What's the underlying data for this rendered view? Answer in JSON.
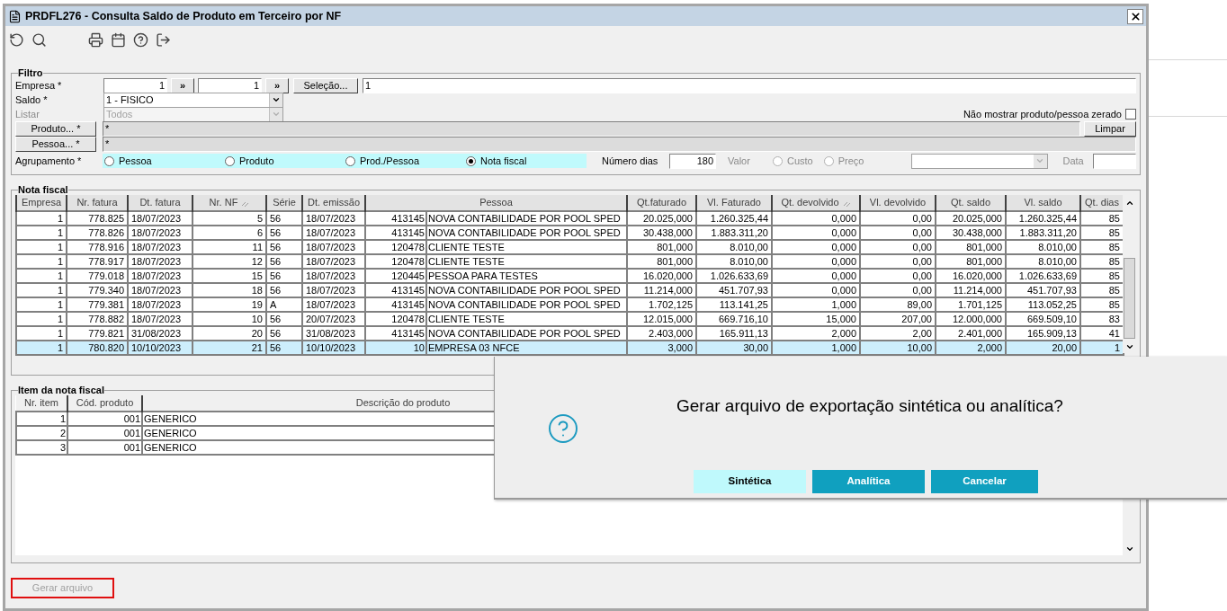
{
  "window": {
    "title": "PRDFL276 - Consulta Saldo de Produto em Terceiro por NF"
  },
  "filter": {
    "title": "Filtro",
    "empresa": {
      "label": "Empresa *",
      "from": "1",
      "from_button": "»",
      "to": "1",
      "to_button": "»",
      "selection_button": "Seleção...",
      "selection_value": "1"
    },
    "saldo": {
      "label": "Saldo *",
      "value": "1 - FISICO",
      "disabled": false
    },
    "listar": {
      "label": "Listar",
      "value": "Todos",
      "disabled": true
    },
    "hide_zero": {
      "label": "Não mostrar produto/pessoa zerado",
      "checked": false
    },
    "produto": {
      "button": "Produto... *",
      "value": "*"
    },
    "pessoa": {
      "button": "Pessoa... *",
      "value": "*"
    },
    "clear_button": "Limpar",
    "agrupamento": {
      "label": "Agrupamento *",
      "options": [
        {
          "label": "Pessoa",
          "selected": false
        },
        {
          "label": "Produto",
          "selected": false
        },
        {
          "label": "Prod./Pessoa",
          "selected": false
        },
        {
          "label": "Nota fiscal",
          "selected": true
        }
      ]
    },
    "numero_dias": {
      "label": "Número dias",
      "value": "180"
    },
    "valor": {
      "label": "Valor",
      "disabled": true,
      "options": [
        {
          "label": "Custo",
          "selected": false
        },
        {
          "label": "Preço",
          "selected": false
        }
      ]
    },
    "data": {
      "label": "Data"
    }
  },
  "nota_fiscal": {
    "title": "Nota fiscal",
    "columns": [
      {
        "label": "Empresa",
        "sorted": false
      },
      {
        "label": "Nr. fatura",
        "sorted": false
      },
      {
        "label": "Dt. fatura",
        "sorted": false
      },
      {
        "label": "Nr. NF",
        "sorted": true
      },
      {
        "label": "Série",
        "sorted": false
      },
      {
        "label": "Dt. emissão",
        "sorted": false
      },
      {
        "label": "Pessoa",
        "sorted": false
      },
      {
        "label": "Qt.faturado",
        "sorted": false
      },
      {
        "label": "Vl. Faturado",
        "sorted": false
      },
      {
        "label": "Qt. devolvido",
        "sorted": true
      },
      {
        "label": "Vl. devolvido",
        "sorted": false
      },
      {
        "label": "Qt. saldo",
        "sorted": false
      },
      {
        "label": "Vl. saldo",
        "sorted": false
      },
      {
        "label": "Qt. dias",
        "sorted": false
      }
    ],
    "rows": [
      {
        "selected": false,
        "cells": [
          "1",
          "778.825",
          "18/07/2023",
          "5",
          "56",
          "18/07/2023",
          {
            "code": "413145",
            "name": "NOVA CONTABILIDADE POR POOL SPED"
          },
          "20.025,000",
          "1.260.325,44",
          "0,000",
          "0,00",
          "20.025,000",
          "1.260.325,44",
          "85"
        ]
      },
      {
        "selected": false,
        "cells": [
          "1",
          "778.826",
          "18/07/2023",
          "6",
          "56",
          "18/07/2023",
          {
            "code": "413145",
            "name": "NOVA CONTABILIDADE POR POOL SPED"
          },
          "30.438,000",
          "1.883.311,20",
          "0,000",
          "0,00",
          "30.438,000",
          "1.883.311,20",
          "85"
        ]
      },
      {
        "selected": false,
        "cells": [
          "1",
          "778.916",
          "18/07/2023",
          "11",
          "56",
          "18/07/2023",
          {
            "code": "120478",
            "name": "CLIENTE TESTE"
          },
          "801,000",
          "8.010,00",
          "0,000",
          "0,00",
          "801,000",
          "8.010,00",
          "85"
        ]
      },
      {
        "selected": false,
        "cells": [
          "1",
          "778.917",
          "18/07/2023",
          "12",
          "56",
          "18/07/2023",
          {
            "code": "120478",
            "name": "CLIENTE TESTE"
          },
          "801,000",
          "8.010,00",
          "0,000",
          "0,00",
          "801,000",
          "8.010,00",
          "85"
        ]
      },
      {
        "selected": false,
        "cells": [
          "1",
          "779.018",
          "18/07/2023",
          "15",
          "56",
          "18/07/2023",
          {
            "code": "120445",
            "name": "PESSOA PARA TESTES"
          },
          "16.020,000",
          "1.026.633,69",
          "0,000",
          "0,00",
          "16.020,000",
          "1.026.633,69",
          "85"
        ]
      },
      {
        "selected": false,
        "cells": [
          "1",
          "779.340",
          "18/07/2023",
          "18",
          "56",
          "18/07/2023",
          {
            "code": "413145",
            "name": "NOVA CONTABILIDADE POR POOL SPED"
          },
          "11.214,000",
          "451.707,93",
          "0,000",
          "0,00",
          "11.214,000",
          "451.707,93",
          "85"
        ]
      },
      {
        "selected": false,
        "cells": [
          "1",
          "779.381",
          "18/07/2023",
          "19",
          "A",
          "18/07/2023",
          {
            "code": "413145",
            "name": "NOVA CONTABILIDADE POR POOL SPED"
          },
          "1.702,125",
          "113.141,25",
          "1,000",
          "89,00",
          "1.701,125",
          "113.052,25",
          "85"
        ]
      },
      {
        "selected": false,
        "cells": [
          "1",
          "778.882",
          "18/07/2023",
          "10",
          "56",
          "20/07/2023",
          {
            "code": "120478",
            "name": "CLIENTE TESTE"
          },
          "12.015,000",
          "669.716,10",
          "15,000",
          "207,00",
          "12.000,000",
          "669.509,10",
          "83"
        ]
      },
      {
        "selected": false,
        "cells": [
          "1",
          "779.821",
          "31/08/2023",
          "20",
          "56",
          "31/08/2023",
          {
            "code": "413145",
            "name": "NOVA CONTABILIDADE POR POOL SPED"
          },
          "2.403,000",
          "165.911,13",
          "2,000",
          "2,00",
          "2.401,000",
          "165.909,13",
          "41"
        ]
      },
      {
        "selected": true,
        "cells": [
          "1",
          "780.820",
          "10/10/2023",
          "21",
          "56",
          "10/10/2023",
          {
            "code": "10",
            "name": "EMPRESA 03 NFCE"
          },
          "3,000",
          "30,00",
          "1,000",
          "10,00",
          "2,000",
          "20,00",
          "1"
        ]
      }
    ]
  },
  "items": {
    "title": "Item da nota fiscal",
    "columns": [
      "Nr. item",
      "Cód. produto",
      "Descrição do produto"
    ],
    "rows": [
      [
        "1",
        "001",
        "GENERICO"
      ],
      [
        "2",
        "001",
        "GENERICO"
      ],
      [
        "3",
        "001",
        "GENERICO"
      ]
    ]
  },
  "generate_button": {
    "label": "Gerar arquivo",
    "disabled": true,
    "highlighted": true
  },
  "dialog": {
    "message": "Gerar arquivo de exportação sintética ou analítica?",
    "buttons": [
      {
        "label": "Sintética",
        "focused": true
      },
      {
        "label": "Analítica",
        "focused": false
      },
      {
        "label": "Cancelar",
        "focused": false
      }
    ]
  }
}
